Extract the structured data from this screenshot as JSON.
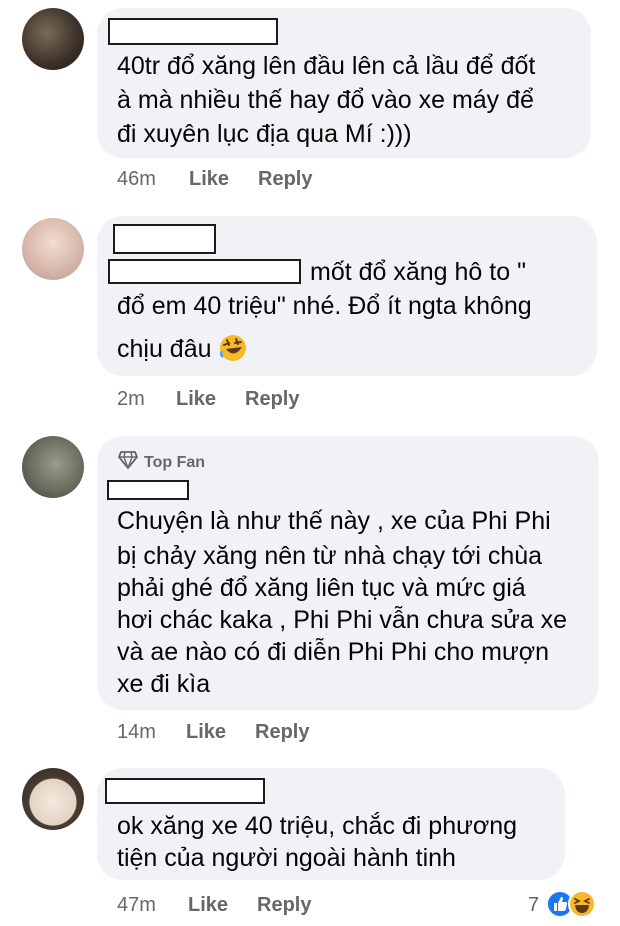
{
  "comments": [
    {
      "lines": [
        "40tr đổ xăng lên đầu lên cả lầu để đốt",
        "à mà nhiều thế hay đổ vào xe máy để",
        "đi xuyên lục địa qua Mí :)))"
      ],
      "time": "46m",
      "like": "Like",
      "reply": "Reply"
    },
    {
      "first_line": "mốt đổ xăng hô to \"",
      "lines": [
        "đổ em 40 triệu\"  nhé. Đổ ít ngta không",
        "chịu đâu"
      ],
      "emoji": "rolling-on-floor-laughing-emoji",
      "time": "2m",
      "like": "Like",
      "reply": "Reply"
    },
    {
      "badge": "Top Fan",
      "lines": [
        "Chuyện là như thế này , xe của Phi Phi",
        "bị chảy xăng nên từ nhà chạy tới chùa",
        "phải ghé đổ xăng liên tục và mức giá",
        "hơi chác kaka , Phi Phi vẫn chưa sửa xe",
        "và ae nào có đi diễn Phi Phi cho mượn",
        "xe đi kìa"
      ],
      "time": "14m",
      "like": "Like",
      "reply": "Reply"
    },
    {
      "lines": [
        "ok xăng xe 40 triệu, chắc đi phương",
        "tiện của người ngoài hành tinh"
      ],
      "time": "47m",
      "like": "Like",
      "reply": "Reply",
      "reaction_count": "7",
      "reaction_icons": [
        "like-reaction-icon",
        "haha-reaction-icon"
      ]
    }
  ],
  "colors": {
    "bubble": "#f0f2f5",
    "meta": "#65676b",
    "like_blue": "#1877f2",
    "haha_yellow": "#f7b928"
  }
}
